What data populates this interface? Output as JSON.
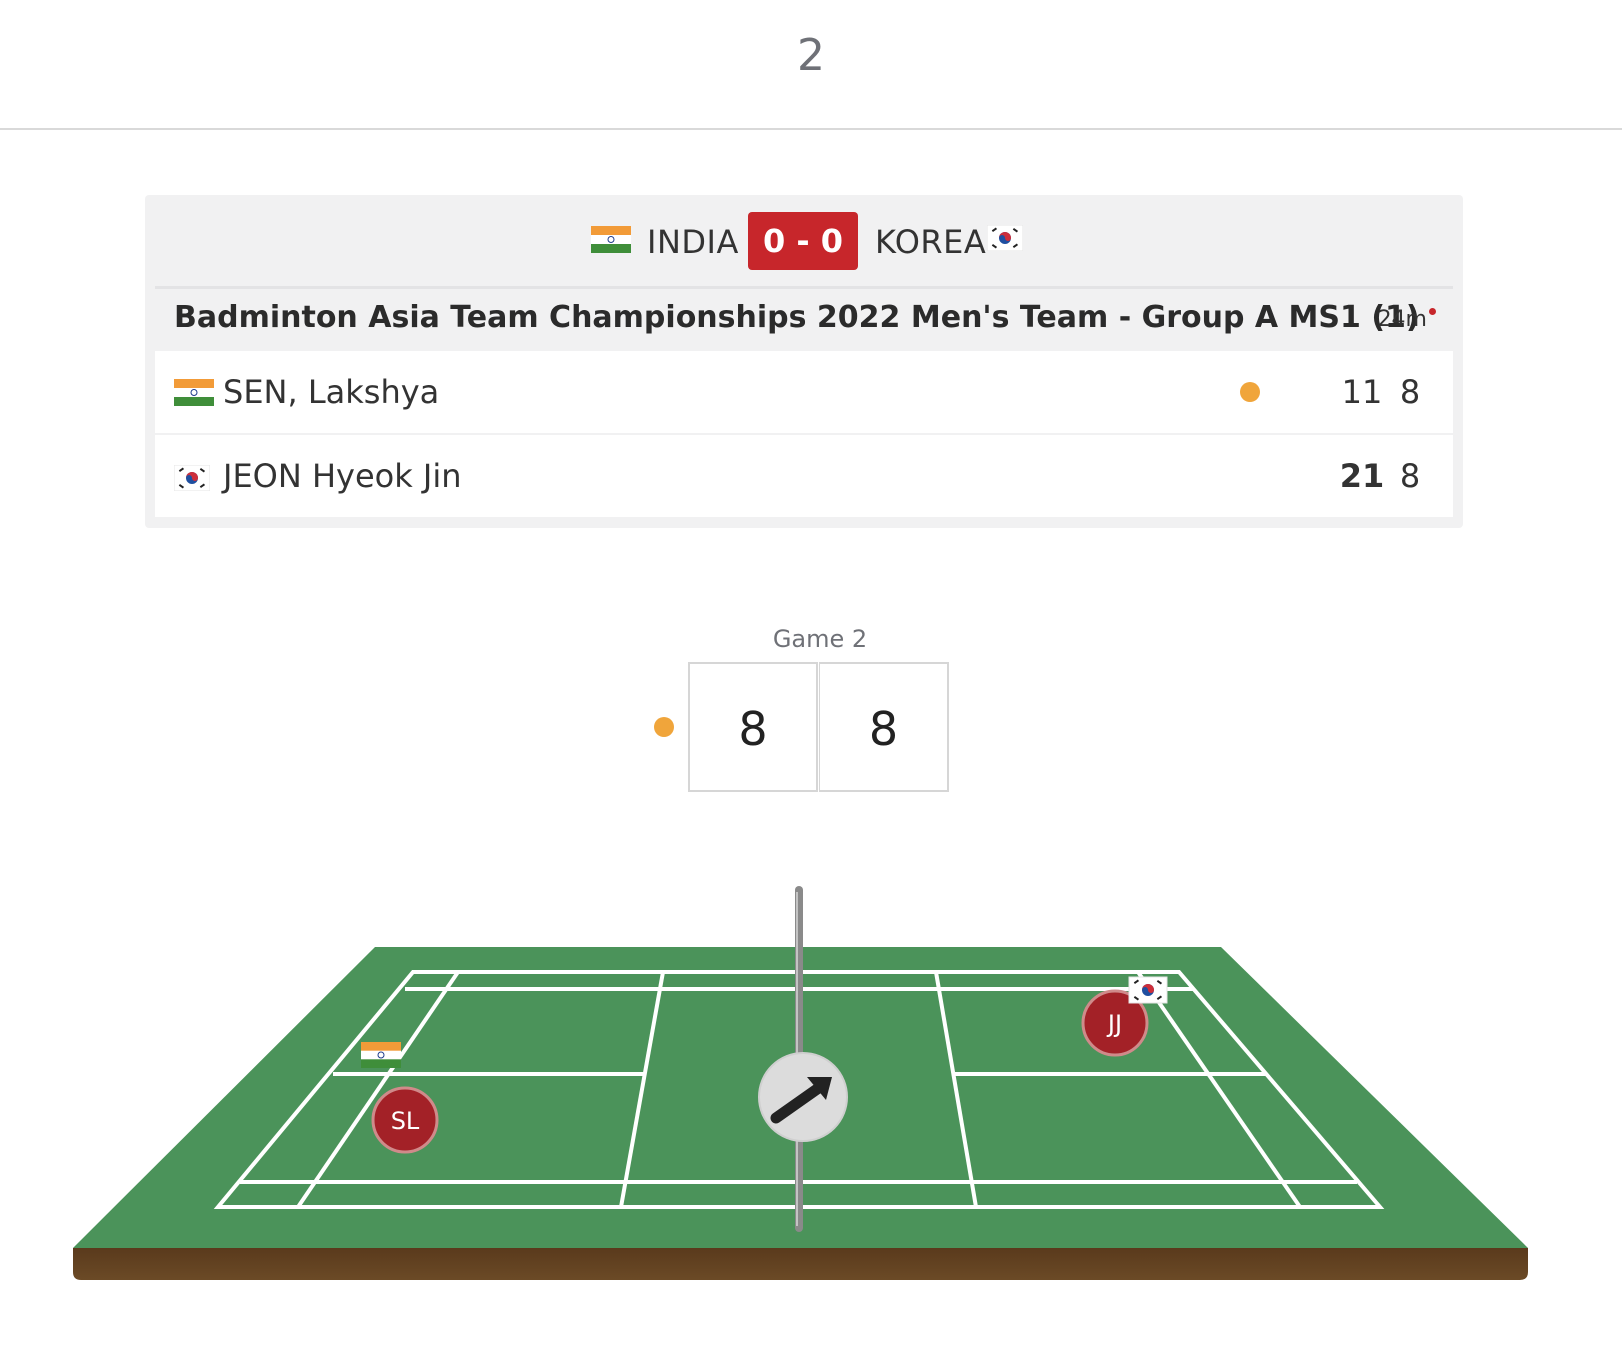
{
  "header": {
    "page_number": "2"
  },
  "match": {
    "team_left": "INDIA",
    "team_right": "KOREA",
    "team_score": "0 - 0",
    "event_title": "Badminton Asia Team Championships 2022 Men's Team - Group A MS1 (1)",
    "duration": "24m"
  },
  "players": [
    {
      "name": "SEN, Lakshya",
      "country": "INDIA",
      "game1": "11",
      "game2": "8",
      "serving": true,
      "game1_won": false
    },
    {
      "name": "JEON Hyeok Jin",
      "country": "KOREA",
      "game1": "21",
      "game2": "8",
      "serving": false,
      "game1_won": true
    }
  ],
  "current_game": {
    "label": "Game 2",
    "score_left": "8",
    "score_right": "8"
  },
  "court": {
    "player_left_initials": "SL",
    "player_right_initials": "JJ",
    "center_icon": "arrow-icon"
  },
  "colors": {
    "accent_red": "#c7262b",
    "serve_orange": "#f0a53b",
    "court_green": "#4b935a",
    "court_edge": "#3f8a4d",
    "court_base": "#5a3a1c",
    "player_marker": "#a32127"
  }
}
